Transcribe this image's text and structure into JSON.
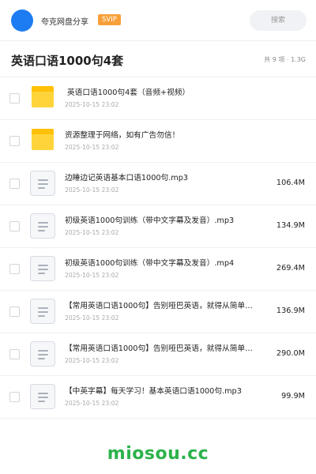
{
  "app": {
    "name": "夸克网盘分享",
    "badge": "SVIP"
  },
  "search": {
    "placeholder": "搜索"
  },
  "header": {
    "title": "英语口语1000句4套",
    "meta": "共 9 项 · 1.3G"
  },
  "files": [
    {
      "type": "folder",
      "name": "英语口语1000句4套（音频+视频）",
      "date": "2025-10-15 23:02",
      "size": ""
    },
    {
      "type": "folder",
      "name": "资源整理于网络，如有广告勿信！",
      "date": "2025-10-15 23:02",
      "size": ""
    },
    {
      "type": "file",
      "name": "边睡边记英语基本口语1000句.mp3",
      "date": "2025-10-15 23:02",
      "size": "106.4M"
    },
    {
      "type": "file",
      "name": "初级英语1000句训练（带中文字幕及发音）.mp3",
      "date": "2025-10-15 23:02",
      "size": "134.9M"
    },
    {
      "type": "file",
      "name": "初级英语1000句训练（带中文字幕及发音）.mp4",
      "date": "2025-10-15 23:02",
      "size": "269.4M"
    },
    {
      "type": "file",
      "name": "【常用英语口语1000句】告别哑巴英语，就得从简单…",
      "date": "2025-10-15 23:02",
      "size": "136.9M"
    },
    {
      "type": "file",
      "name": "【常用英语口语1000句】告别哑巴英语，就得从简单…",
      "date": "2025-10-15 23:02",
      "size": "290.0M"
    },
    {
      "type": "file",
      "name": "【中英字幕】每天学习！基本英语口语1000句.mp3",
      "date": "2025-10-15 23:02",
      "size": "99.9M"
    }
  ],
  "watermark": "miosou.cc",
  "colors": {
    "accent": "#1e7cf2",
    "badge": "#f7a03a",
    "folder": "#ffd43b",
    "watermark": "#2cb24b"
  }
}
